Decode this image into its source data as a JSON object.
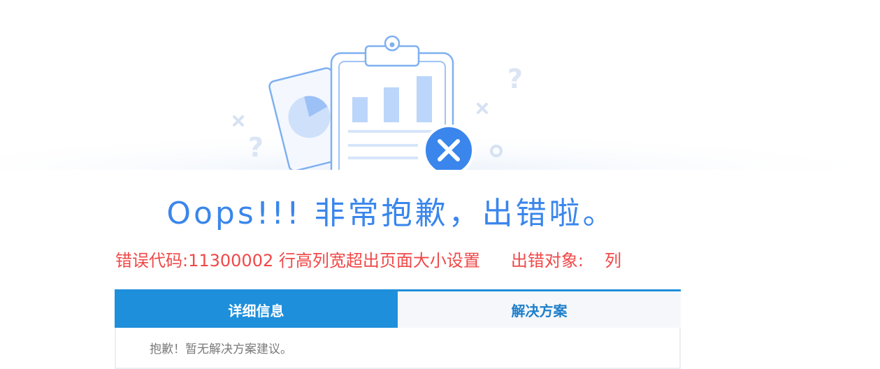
{
  "headline": "Oops!!! 非常抱歉，出错啦。",
  "error": {
    "code_label": "错误代码:11300002 行高列宽超出页面大小设置",
    "target_label": "出错对象:",
    "target_value": "列"
  },
  "tabs": [
    {
      "label": "详细信息",
      "active": true
    },
    {
      "label": "解决方案",
      "active": false
    }
  ],
  "panel_body": "抱歉！暂无解决方案建议。",
  "colors": {
    "accent": "#3a86ec",
    "error_text": "#f04848",
    "tab_active": "#1e8fdb",
    "close_badge": "#3a86ec"
  },
  "icons": [
    "clipboard-chart-icon",
    "pie-chart-card-icon",
    "close-icon",
    "question-mark-icon",
    "cross-mark-icon",
    "circle-mark-icon"
  ]
}
